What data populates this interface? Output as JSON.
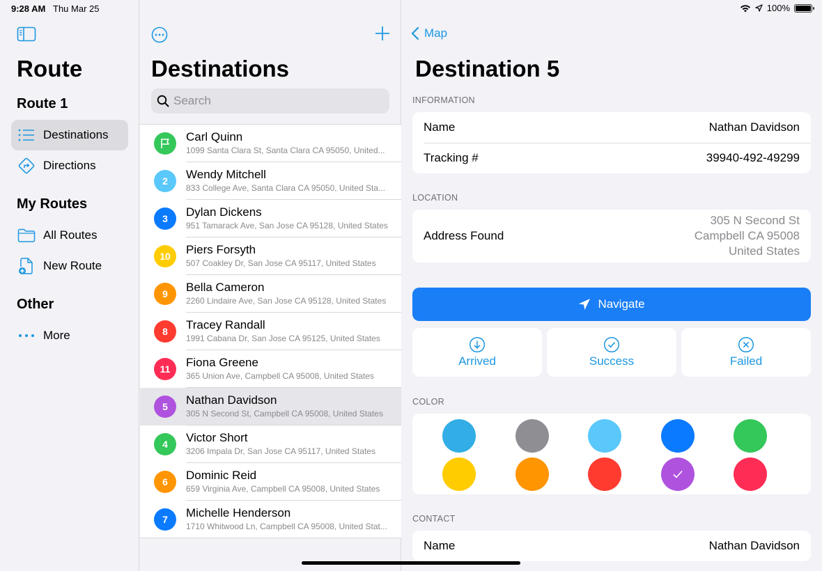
{
  "status": {
    "time": "9:28 AM",
    "date": "Thu Mar 25",
    "battery": "100%"
  },
  "sidebar": {
    "title": "Route",
    "section_route": "Route 1",
    "items_route": [
      {
        "label": "Destinations",
        "icon": "list-bullet-icon",
        "active": true
      },
      {
        "label": "Directions",
        "icon": "directions-sign-icon",
        "active": false
      }
    ],
    "section_my_routes": "My Routes",
    "items_my_routes": [
      {
        "label": "All Routes",
        "icon": "folder-icon"
      },
      {
        "label": "New Route",
        "icon": "new-document-icon"
      }
    ],
    "section_other": "Other",
    "items_other": [
      {
        "label": "More",
        "icon": "ellipsis-icon"
      }
    ]
  },
  "list": {
    "title": "Destinations",
    "search_placeholder": "Search",
    "rows": [
      {
        "badge": "",
        "badge_icon": "flag-icon",
        "color": "#34c759",
        "name": "Carl Quinn",
        "address": "1099 Santa Clara St, Santa Clara CA 95050, United..."
      },
      {
        "badge": "2",
        "color": "#5ac8fa",
        "name": "Wendy Mitchell",
        "address": "833 College Ave, Santa Clara CA 95050, United Sta..."
      },
      {
        "badge": "3",
        "color": "#0a7aff",
        "name": "Dylan Dickens",
        "address": "951 Tamarack Ave, San Jose CA 95128, United States"
      },
      {
        "badge": "10",
        "color": "#ffcc00",
        "name": "Piers Forsyth",
        "address": "507 Coakley Dr, San Jose CA 95117, United States"
      },
      {
        "badge": "9",
        "color": "#ff9500",
        "name": "Bella Cameron",
        "address": "2260 Lindaire Ave, San Jose CA 95128, United States"
      },
      {
        "badge": "8",
        "color": "#ff3b30",
        "name": "Tracey Randall",
        "address": "1991 Cabana Dr, San Jose CA 95125, United States"
      },
      {
        "badge": "11",
        "color": "#ff2d55",
        "name": "Fiona Greene",
        "address": "365 Union Ave, Campbell CA 95008, United States"
      },
      {
        "badge": "5",
        "color": "#af52de",
        "name": "Nathan Davidson",
        "address": "305 N Second St, Campbell CA 95008, United States",
        "selected": true
      },
      {
        "badge": "4",
        "color": "#34c759",
        "name": "Victor Short",
        "address": "3206 Impala Dr, San Jose CA 95117, United States"
      },
      {
        "badge": "6",
        "color": "#ff9500",
        "name": "Dominic Reid",
        "address": "659 Virginia Ave, Campbell CA 95008, United States"
      },
      {
        "badge": "7",
        "color": "#0a7aff",
        "name": "Michelle Henderson",
        "address": "1710 Whitwood Ln, Campbell CA 95008, United Stat..."
      }
    ]
  },
  "detail": {
    "back_label": "Map",
    "title": "Destination 5",
    "information_label": "INFORMATION",
    "name_label": "Name",
    "name_value": "Nathan Davidson",
    "tracking_label": "Tracking #",
    "tracking_value": "39940-492-49299",
    "location_label": "LOCATION",
    "address_label": "Address Found",
    "address_lines": [
      "305 N Second St",
      "Campbell CA 95008",
      "United States"
    ],
    "navigate_label": "Navigate",
    "actions": [
      {
        "label": "Arrived",
        "icon": "arrow-down-circle-icon"
      },
      {
        "label": "Success",
        "icon": "checkmark-circle-icon"
      },
      {
        "label": "Failed",
        "icon": "x-circle-icon"
      }
    ],
    "color_label": "COLOR",
    "colors": [
      "#32ade6",
      "#8e8e93",
      "#5ac8fa",
      "#0a7aff",
      "#34c759",
      "#ffcc00",
      "#ff9500",
      "#ff3b30",
      "#af52de",
      "#ff2d55"
    ],
    "selected_color": "#af52de",
    "contact_label": "CONTACT",
    "contact_name_label": "Name",
    "contact_name_value": "Nathan Davidson"
  },
  "accent_color": "#1c97e0"
}
